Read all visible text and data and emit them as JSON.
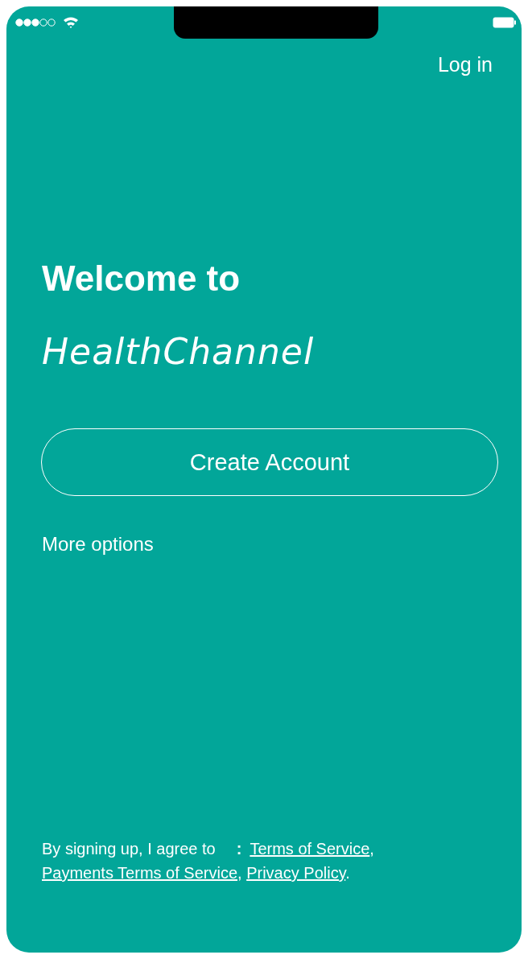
{
  "header": {
    "login": "Log in"
  },
  "welcome": {
    "line1": "Welcome to",
    "brand": "HealthChannel"
  },
  "buttons": [
    {
      "label": "Create Account",
      "kind": "outline"
    },
    {
      "label": "More options",
      "kind": "text"
    }
  ],
  "legal": {
    "prefix": "By signing up, I agree to",
    "colon": ":",
    "links": [
      {
        "label": "Terms of Service",
        "suffix": ","
      },
      {
        "label": "Payments Terms of Service",
        "suffix": ","
      },
      {
        "label": "Privacy Policy",
        "suffix": "."
      }
    ]
  }
}
